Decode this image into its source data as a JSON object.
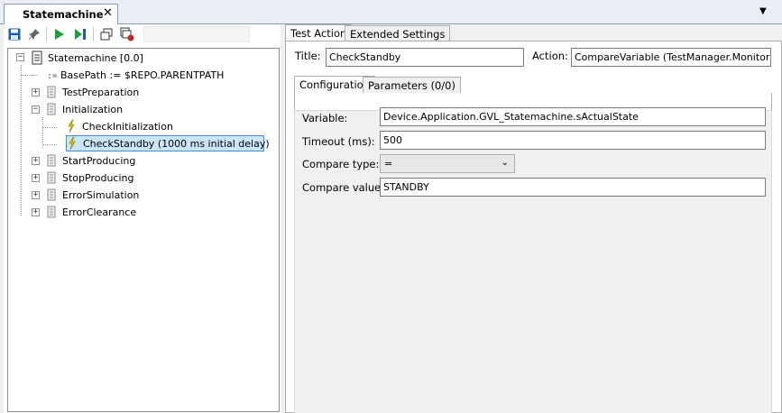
{
  "document_tab": {
    "label": "Statemachine",
    "close": "✕",
    "dropdown": "▼"
  },
  "tree": {
    "root": "Statemachine [0.0]",
    "basepath": "BasePath := $REPO.PARENTPATH",
    "items": {
      "test_preparation": "TestPreparation",
      "initialization": "Initialization",
      "check_initialization": "CheckInitialization",
      "check_standby": "CheckStandby (1000 ms initial delay)",
      "start_producing": "StartProducing",
      "stop_producing": "StopProducing",
      "error_simulation": "ErrorSimulation",
      "error_clearance": "ErrorClearance"
    }
  },
  "right_tabs": {
    "test_action": "Test Action",
    "extended_settings": "Extended Settings"
  },
  "header": {
    "title_label": "Title:",
    "title_value": "CheckStandby",
    "action_label": "Action:",
    "action_value": "CompareVariable (TestManager.Monitoring)"
  },
  "inner_tabs": {
    "configuration": "Configuration",
    "parameters": "Parameters (0/0)"
  },
  "config": {
    "variable_label": "Variable:",
    "variable_value": "Device.Application.GVL_Statemachine.sActualState",
    "timeout_label": "Timeout (ms):",
    "timeout_value": "500",
    "compare_type_label": "Compare type:",
    "compare_type_value": "=",
    "compare_value_label": "Compare value:",
    "compare_value_value": "STANDBY"
  },
  "colors": {
    "tab_strip": "#e9eef5",
    "selection_fill": "#cce4f7",
    "selection_border": "#3c8cd6",
    "play_green": "#1e9d3a",
    "save_blue": "#1a5fa8",
    "action_yellow": "#e3c200"
  },
  "icons": {
    "save": "save-icon",
    "pin": "pin-icon",
    "run": "play-icon",
    "step": "step-icon",
    "copy": "copy-icon",
    "record": "record-icon",
    "script": "script-icon",
    "variable": "variable-icon",
    "sequence": "sequence-icon",
    "action": "action-icon"
  }
}
